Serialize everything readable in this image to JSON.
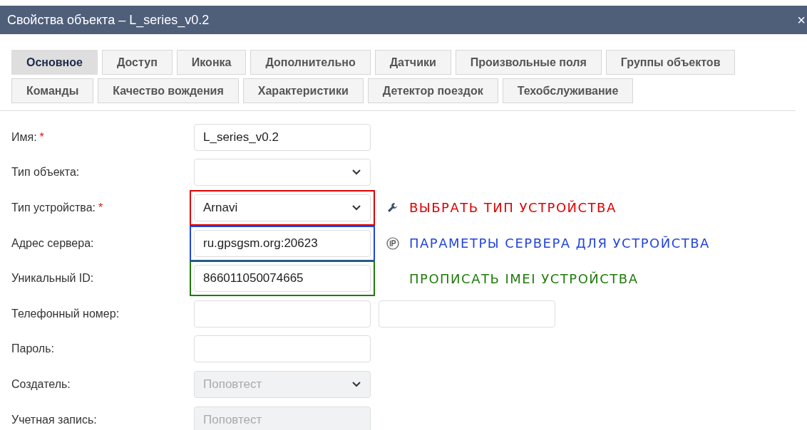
{
  "window": {
    "title": "Свойства объекта – L_series_v0.2",
    "close": "×"
  },
  "tabs": [
    {
      "label": "Основное",
      "selected": true
    },
    {
      "label": "Доступ",
      "selected": false
    },
    {
      "label": "Иконка",
      "selected": false
    },
    {
      "label": "Дополнительно",
      "selected": false
    },
    {
      "label": "Датчики",
      "selected": false
    },
    {
      "label": "Произвольные поля",
      "selected": false
    },
    {
      "label": "Группы объектов",
      "selected": false
    },
    {
      "label": "Команды",
      "selected": false
    },
    {
      "label": "Качество вождения",
      "selected": false
    },
    {
      "label": "Характеристики",
      "selected": false
    },
    {
      "label": "Детектор поездок",
      "selected": false
    },
    {
      "label": "Техобслуживание",
      "selected": false
    }
  ],
  "form": [
    {
      "label": "Имя:",
      "required": "*",
      "fields": [
        {
          "kind": "input",
          "value": "L_series_v0.2",
          "disabled": false
        }
      ]
    },
    {
      "label": "Тип объекта:",
      "fields": [
        {
          "kind": "select",
          "disabled": false
        }
      ]
    },
    {
      "label": "Тип устройства:",
      "required": "*",
      "color": "#dd0000",
      "fields": [
        {
          "kind": "select",
          "value": "Arnavi",
          "disabled": false
        }
      ],
      "note": {
        "kind": "wrench",
        "text": "ВЫБРАТЬ ТИП УСТРОЙСТВА",
        "color": "#dd0000"
      }
    },
    {
      "label": "Адрес сервера:",
      "color": "#2244dd",
      "fields": [
        {
          "kind": "input",
          "value": "ru.gpsgsm.org:20623",
          "disabled": false
        }
      ],
      "note": {
        "kind": "ip",
        "text": "ПАРАМЕТРЫ СЕРВЕРА ДЛЯ УСТРОЙСТВА",
        "color": "#2244dd"
      }
    },
    {
      "label": "Уникальный ID:",
      "color": "#1f7a0a",
      "fields": [
        {
          "kind": "input",
          "value": "866011050074665",
          "disabled": false
        }
      ],
      "note": {
        "kind": "plain",
        "text": "ПРОПИСАТЬ IMEI УСТРОЙСТВА",
        "color": "#1f7a0a"
      }
    },
    {
      "label": "Телефонный номер:",
      "fields": [
        {
          "kind": "input",
          "disabled": false
        },
        {
          "kind": "input",
          "disabled": false
        }
      ]
    },
    {
      "label": "Пароль:",
      "fields": [
        {
          "kind": "input",
          "disabled": false
        }
      ]
    },
    {
      "label": "Создатель:",
      "fields": [
        {
          "kind": "select",
          "value": "Поповтест",
          "disabled": true
        }
      ]
    },
    {
      "label": "Учетная запись:",
      "fields": [
        {
          "kind": "input",
          "value": "Поповтест",
          "disabled": true
        }
      ]
    }
  ]
}
